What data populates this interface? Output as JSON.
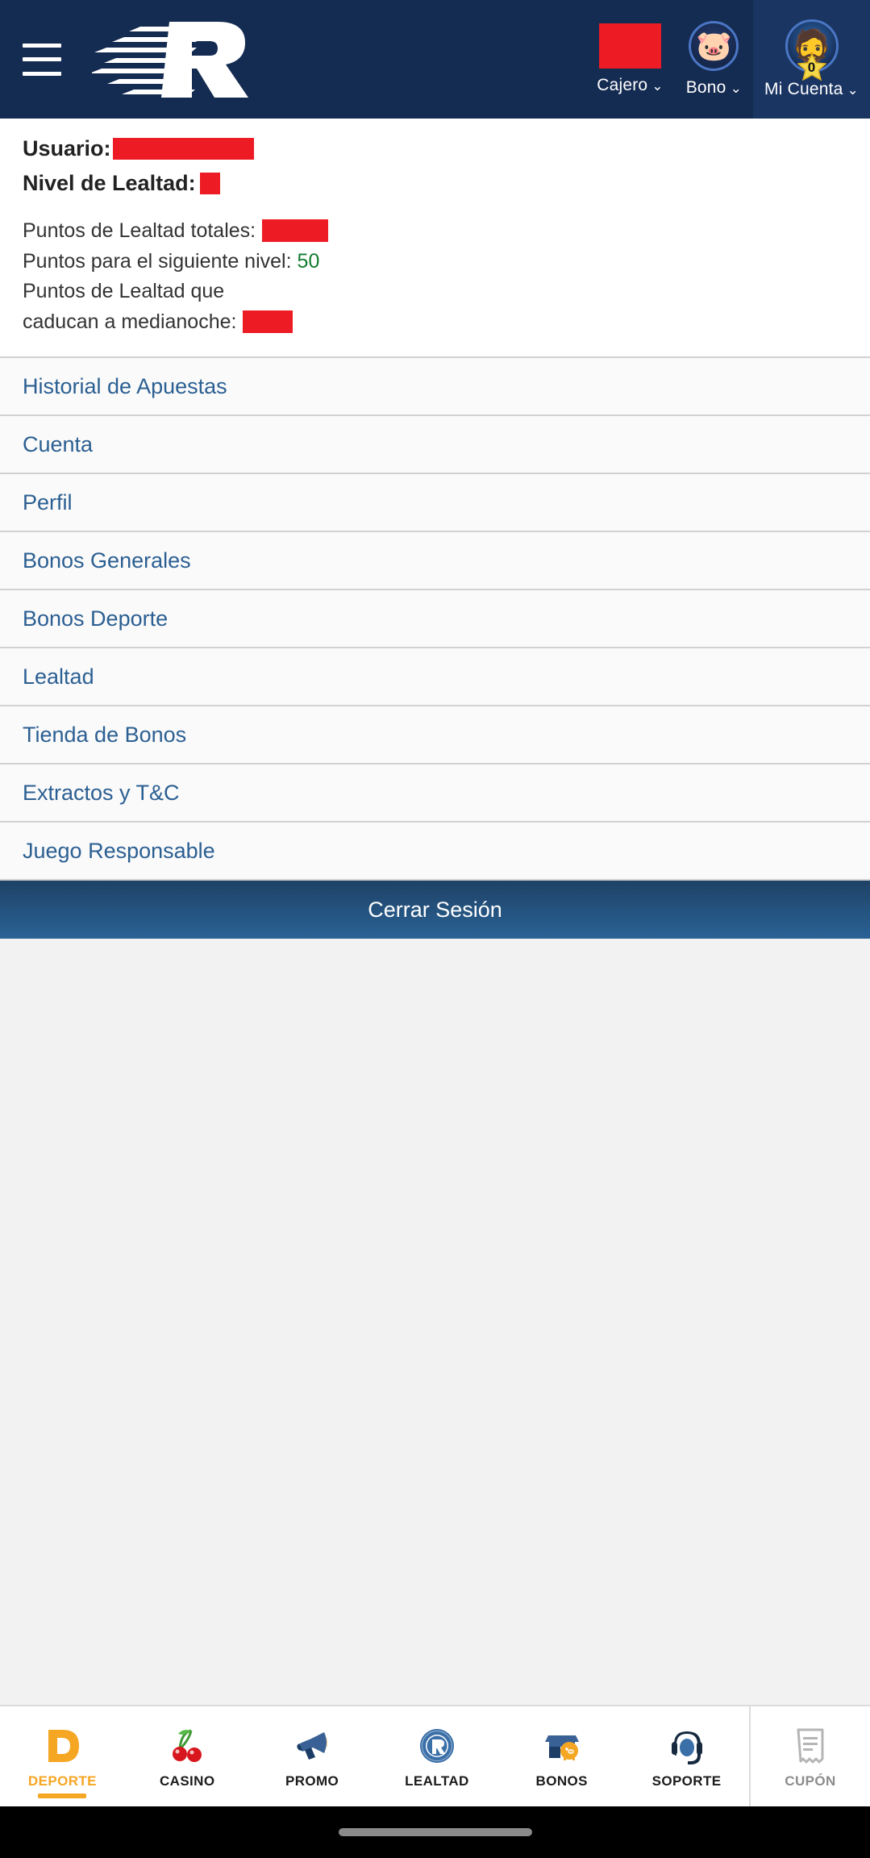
{
  "header": {
    "menu_icon": "hamburger-icon",
    "logo_alt": "R",
    "items": [
      {
        "label": "Cajero",
        "icon": "balance-box",
        "chevron": "⌄",
        "active": false
      },
      {
        "label": "Bono",
        "icon": "piggy-bank-icon",
        "chevron": "⌄",
        "active": false
      },
      {
        "label": "Mi Cuenta",
        "icon": "avatar-icon",
        "chevron": "⌄",
        "active": true
      }
    ],
    "avatar_level": "0",
    "piggy_glyph": "🐷",
    "avatar_glyph": "🧔",
    "bg_color": "#142b52",
    "active_bg_color": "#1b3563"
  },
  "userinfo": {
    "usuario_label": "Usuario:",
    "nivel_label": "Nivel de Lealtad:",
    "puntos_totales_label": "Puntos de Lealtad totales:",
    "puntos_siguiente_label": "Puntos para el siguiente nivel:",
    "puntos_siguiente_value": "50",
    "puntos_caducan_label_line1": "Puntos de Lealtad que",
    "puntos_caducan_label_line2": "caducan a medianoche:",
    "redaction_color": "#ED1C24",
    "green_value_color": "#127c2f"
  },
  "menu": {
    "items": [
      {
        "label": "Historial de Apuestas"
      },
      {
        "label": "Cuenta"
      },
      {
        "label": "Perfil"
      },
      {
        "label": "Bonos Generales"
      },
      {
        "label": "Bonos Deporte"
      },
      {
        "label": "Lealtad"
      },
      {
        "label": "Tienda de Bonos"
      },
      {
        "label": "Extractos y T&C"
      },
      {
        "label": "Juego Responsable"
      }
    ],
    "link_color": "#2b5f92"
  },
  "logout": {
    "label": "Cerrar Sesión"
  },
  "bottomnav": {
    "items": [
      {
        "label": "DEPORTE",
        "icon": "deporte-d-icon",
        "active": true
      },
      {
        "label": "CASINO",
        "icon": "cherries-icon",
        "active": false
      },
      {
        "label": "PROMO",
        "icon": "megaphone-icon",
        "active": false
      },
      {
        "label": "LEALTAD",
        "icon": "rewards-seal-icon",
        "active": false
      },
      {
        "label": "BONOS",
        "icon": "shop-piggy-icon",
        "active": false
      },
      {
        "label": "SOPORTE",
        "icon": "headset-icon",
        "active": false
      }
    ],
    "coupon": {
      "label": "CUPÓN",
      "icon": "receipt-icon",
      "disabled": true
    },
    "active_color": "#F5A623",
    "label_color": "#1b1b1b",
    "disabled_color": "#8c8c8c"
  }
}
